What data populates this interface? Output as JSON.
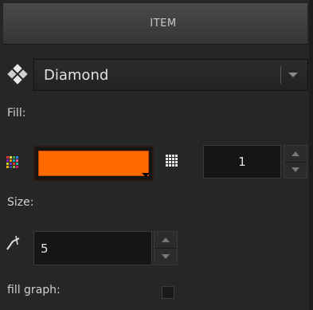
{
  "header": {
    "title": "ITEM"
  },
  "shape": {
    "icon": "diamond-shape-icon",
    "selected": "Diamond"
  },
  "fill": {
    "label": "Fill:",
    "color": "#ff6a00",
    "pattern_icon": "grid-pattern-icon",
    "pattern_value": "1"
  },
  "size": {
    "label": "Size:",
    "icon": "size-line-icon",
    "value": "5"
  },
  "fill_graph": {
    "label": "fill graph:",
    "checked": false
  }
}
